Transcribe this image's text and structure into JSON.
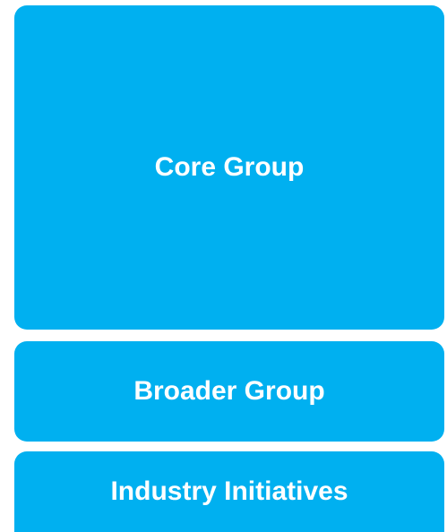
{
  "blocks": [
    {
      "label": "Core Group"
    },
    {
      "label": "Broader Group"
    },
    {
      "label": "Industry Initiatives"
    }
  ],
  "colors": {
    "block_fill": "#00b0f0",
    "block_text": "#ffffff",
    "background": "#ffffff"
  }
}
